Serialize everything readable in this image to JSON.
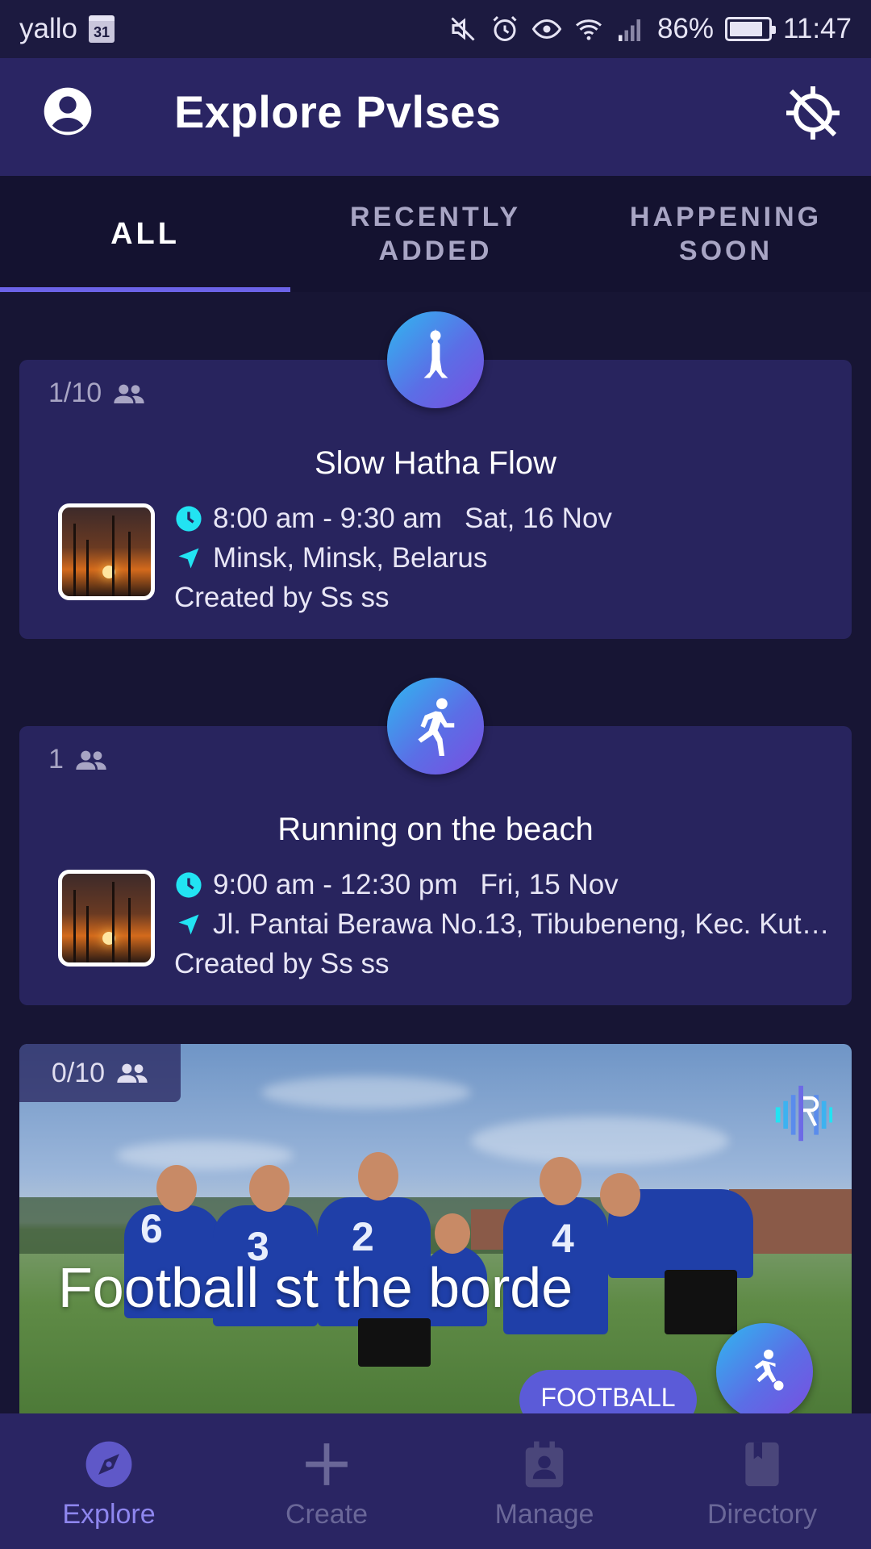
{
  "status_bar": {
    "carrier": "yallo",
    "calendar_day": "31",
    "battery": "86%",
    "battery_level": 0.86,
    "time": "11:47"
  },
  "app_bar": {
    "title": "Explore Pvlses",
    "left_icon": "account-circle-icon",
    "right_icon": "gps-off-icon"
  },
  "tabs": [
    {
      "label": "ALL",
      "active": true
    },
    {
      "label": "RECENTLY\nADDED",
      "active": false
    },
    {
      "label": "HAPPENING\nSOON",
      "active": false
    }
  ],
  "cards": [
    {
      "count": "1/10",
      "title": "Slow Hatha Flow",
      "time": "8:00 am - 9:30 am",
      "date": "Sat, 16 Nov",
      "location": "Minsk, Minsk, Belarus",
      "creator": "Created by Ss ss",
      "activity_icon": "yoga-icon"
    },
    {
      "count": "1",
      "title": "Running on the beach",
      "time": "9:00 am - 12:30 pm",
      "date": "Fri, 15 Nov",
      "location": "Jl. Pantai Berawa No.13, Tibubeneng, Kec. Kuta…",
      "creator": "Created by Ss ss",
      "activity_icon": "running-icon"
    }
  ],
  "image_card": {
    "count": "0/10",
    "title": "Football st the borde",
    "tag": "FOOTBALL",
    "jersey_numbers": [
      "6",
      "3",
      "2",
      "4"
    ],
    "activity_icon": "football-icon"
  },
  "bottom_nav": [
    {
      "label": "Explore",
      "icon": "compass-icon",
      "active": true
    },
    {
      "label": "Create",
      "icon": "plus-icon",
      "active": false
    },
    {
      "label": "Manage",
      "icon": "calendar-person-icon",
      "active": false
    },
    {
      "label": "Directory",
      "icon": "book-icon",
      "active": false
    }
  ],
  "colors": {
    "background": "#171534",
    "app_bar": "#2a2563",
    "card": "#28245e",
    "accent": "#6c63e8",
    "icon_cyan": "#22e3f2"
  }
}
